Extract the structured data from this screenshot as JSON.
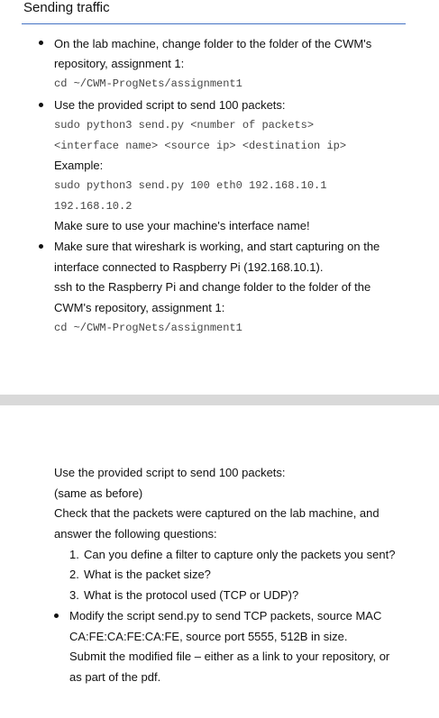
{
  "page1": {
    "title": "Sending traffic",
    "item1": {
      "line1": "On the lab machine, change folder to the folder of the CWM's",
      "line2": "repository, assignment 1:",
      "code": "cd ~/CWM-ProgNets/assignment1"
    },
    "item2": {
      "line1": "Use the provided script to send 100 packets:",
      "code1": "sudo python3 send.py <number of packets>",
      "code2": "<interface name> <source ip> <destination ip>",
      "example_label": "Example:",
      "code3": "sudo python3 send.py 100 eth0 192.168.10.1",
      "code4": "192.168.10.2",
      "note": "Make sure to use your machine's interface name!"
    },
    "item3": {
      "line1": "Make sure that wireshark is working, and start capturing on the",
      "line2": "interface connected to Raspberry Pi (192.168.10.1).",
      "line3": "ssh to the Raspberry Pi and change folder to the folder of the",
      "line4": "CWM's repository, assignment 1:",
      "code": "cd ~/CWM-ProgNets/assignment1"
    }
  },
  "page2": {
    "line1": "Use the provided script to send 100 packets:",
    "line2": "(same as before)",
    "line3": "Check that the packets were captured on the lab machine, and",
    "line4": "answer the following questions:",
    "questions": [
      {
        "num": "1.",
        "text": "Can you define a filter to capture only the packets you sent?"
      },
      {
        "num": "2.",
        "text": "What is the packet size?"
      },
      {
        "num": "3.",
        "text": "What is the protocol used (TCP or UDP)?"
      }
    ],
    "bullet": {
      "line1": "Modify the script send.py to send TCP packets, source MAC",
      "line2": "CA:FE:CA:FE:CA:FE, source port 5555, 512B in size.",
      "line3": "Submit the modified file – either as a link to your repository, or",
      "line4": "as part of the pdf."
    }
  }
}
